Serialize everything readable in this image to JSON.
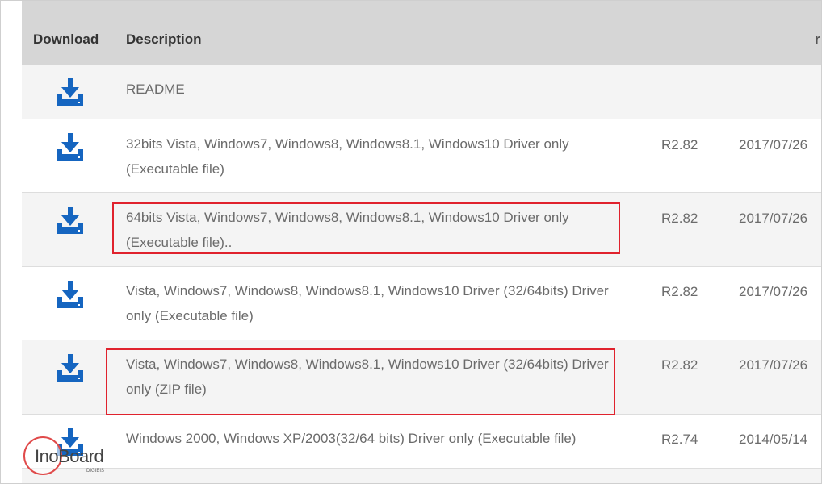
{
  "table": {
    "headers": {
      "download": "Download",
      "description": "Description",
      "extra": "r"
    },
    "rows": [
      {
        "description": "README",
        "version": "",
        "date": "",
        "icon": "download-icon"
      },
      {
        "description": "32bits Vista, Windows7, Windows8, Windows8.1, Windows10 Driver only (Executable file)",
        "version": "R2.82",
        "date": "2017/07/26",
        "icon": "download-icon"
      },
      {
        "description": "64bits Vista, Windows7, Windows8, Windows8.1, Windows10 Driver only (Executable file)..",
        "version": "R2.82",
        "date": "2017/07/26",
        "icon": "download-icon"
      },
      {
        "description": "Vista, Windows7, Windows8, Windows8.1, Windows10 Driver (32/64bits) Driver only (Executable file)",
        "version": "R2.82",
        "date": "2017/07/26",
        "icon": "download-icon"
      },
      {
        "description": "Vista, Windows7, Windows8, Windows8.1, Windows10 Driver (32/64bits) Driver only (ZIP file)",
        "version": "R2.82",
        "date": "2017/07/26",
        "icon": "download-icon"
      },
      {
        "description": "Windows 2000, Windows XP/2003(32/64 bits) Driver only (Executable file)",
        "version": "R2.74",
        "date": "2014/05/14",
        "icon": "download-icon"
      }
    ]
  },
  "watermark": {
    "brand": "InoBoard",
    "tagline": "DIGIBIS"
  },
  "colors": {
    "accent": "#1565c0",
    "highlight": "#e0222d",
    "header_bg": "#d6d6d6"
  }
}
